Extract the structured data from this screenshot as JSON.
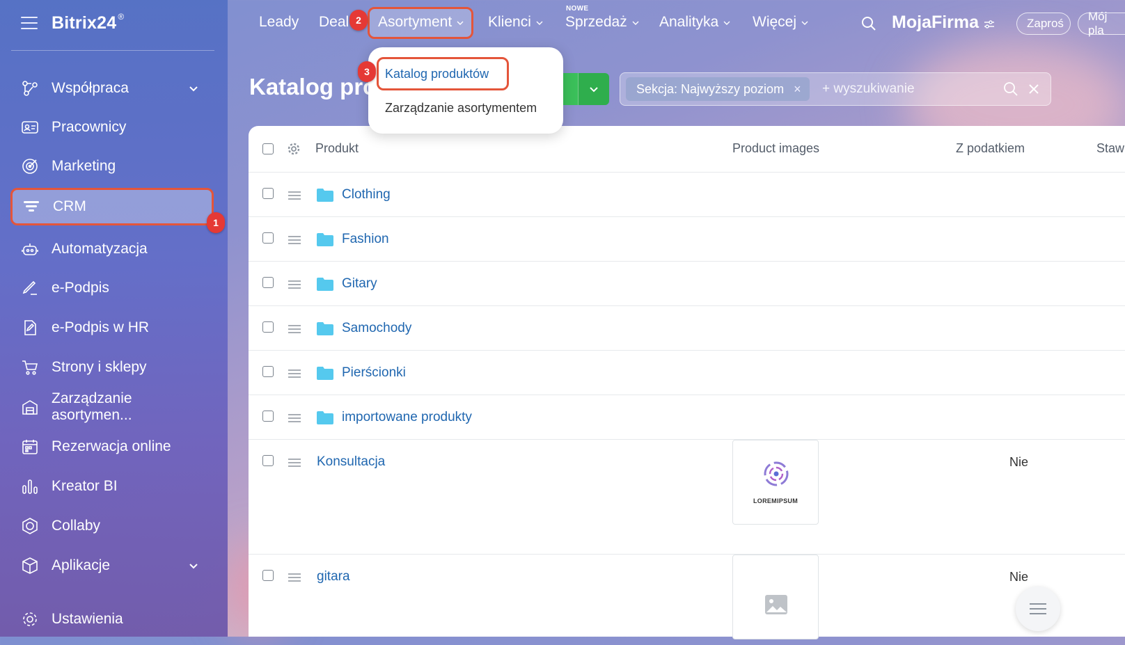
{
  "sidebar": {
    "app_name": "Bitrix24",
    "app_mark": "®",
    "items": [
      {
        "label": "Współpraca",
        "icon": "collaboration-icon",
        "chevron": true
      },
      {
        "label": "Pracownicy",
        "icon": "employees-icon"
      },
      {
        "label": "Marketing",
        "icon": "marketing-icon"
      },
      {
        "label": "CRM",
        "icon": "crm-filter-icon",
        "active": true
      },
      {
        "label": "Automatyzacja",
        "icon": "automation-robot-icon"
      },
      {
        "label": "e-Podpis",
        "icon": "signature-pen-icon"
      },
      {
        "label": "e-Podpis w HR",
        "icon": "signature-document-icon"
      },
      {
        "label": "Strony i sklepy",
        "icon": "shopping-cart-icon"
      },
      {
        "label": "Zarządzanie asortymen...",
        "icon": "warehouse-icon"
      },
      {
        "label": "Rezerwacja online",
        "icon": "calendar-icon"
      },
      {
        "label": "Kreator BI",
        "icon": "bar-chart-icon"
      },
      {
        "label": "Collaby",
        "icon": "hexagon-icon"
      },
      {
        "label": "Aplikacje",
        "icon": "cube-icon",
        "chevron": true
      },
      {
        "label": "Ustawienia",
        "icon": "gear-icon"
      }
    ]
  },
  "topnav": {
    "items": [
      {
        "label": "Leady"
      },
      {
        "label": "Deal"
      },
      {
        "label": "Asortyment"
      },
      {
        "label": "Klienci"
      },
      {
        "label": "Sprzedaż"
      },
      {
        "label": "Analityka"
      },
      {
        "label": "Więcej"
      }
    ],
    "new_badge": "NOWE",
    "brand": "MojaFirma",
    "invite_label": "Zaproś",
    "plan_label": "Mój pla"
  },
  "markers": {
    "one": "1",
    "two": "2",
    "three": "3"
  },
  "page": {
    "title": "Katalog pro",
    "filter_chip": "Sekcja: Najwyższy poziom",
    "filter_placeholder": "+ wyszukiwanie"
  },
  "dropdown": {
    "items": [
      "Katalog produktów",
      "Zarządzanie asortymentem"
    ]
  },
  "table": {
    "columns": [
      "Produkt",
      "Product images",
      "Z podatkiem",
      "Stawk"
    ],
    "folders": [
      "Clothing",
      "Fashion",
      "Gitary",
      "Samochody",
      "Pierścionki",
      "importowane produkty"
    ],
    "products": [
      {
        "name": "Konsultacja",
        "tax": "Nie",
        "image_text": "LOREMIPSUM"
      },
      {
        "name": "gitara",
        "tax": "Nie"
      }
    ]
  },
  "colors": {
    "accent_link": "#2067b0",
    "highlight_border": "#e4553a",
    "marker": "#e53935",
    "green": "#3bc05a"
  }
}
